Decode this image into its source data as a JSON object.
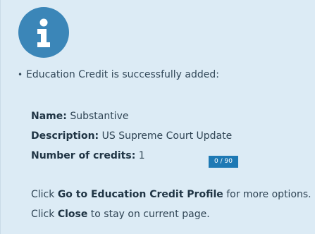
{
  "dialog": {
    "icon": "info-icon",
    "message": "Education Credit is successfully added:",
    "bullet": "•",
    "name_label": "Name:",
    "name_value": "Substantive",
    "description_label": "Description:",
    "description_value": "US Supreme Court Update",
    "credits_label": "Number of credits:",
    "credits_value": "1",
    "char_counter": "0 / 90",
    "line1_prefix": "Click",
    "line1_action": "Go to Education Credit Profile",
    "line1_suffix": "for more options.",
    "line2_prefix": "Click",
    "line2_action": "Close",
    "line2_suffix": "to stay on current page."
  },
  "colors": {
    "panel_bg": "#dcebf5",
    "icon_bg": "#3b86b8",
    "counter_bg": "#1e79b4",
    "text": "#2f4454"
  }
}
